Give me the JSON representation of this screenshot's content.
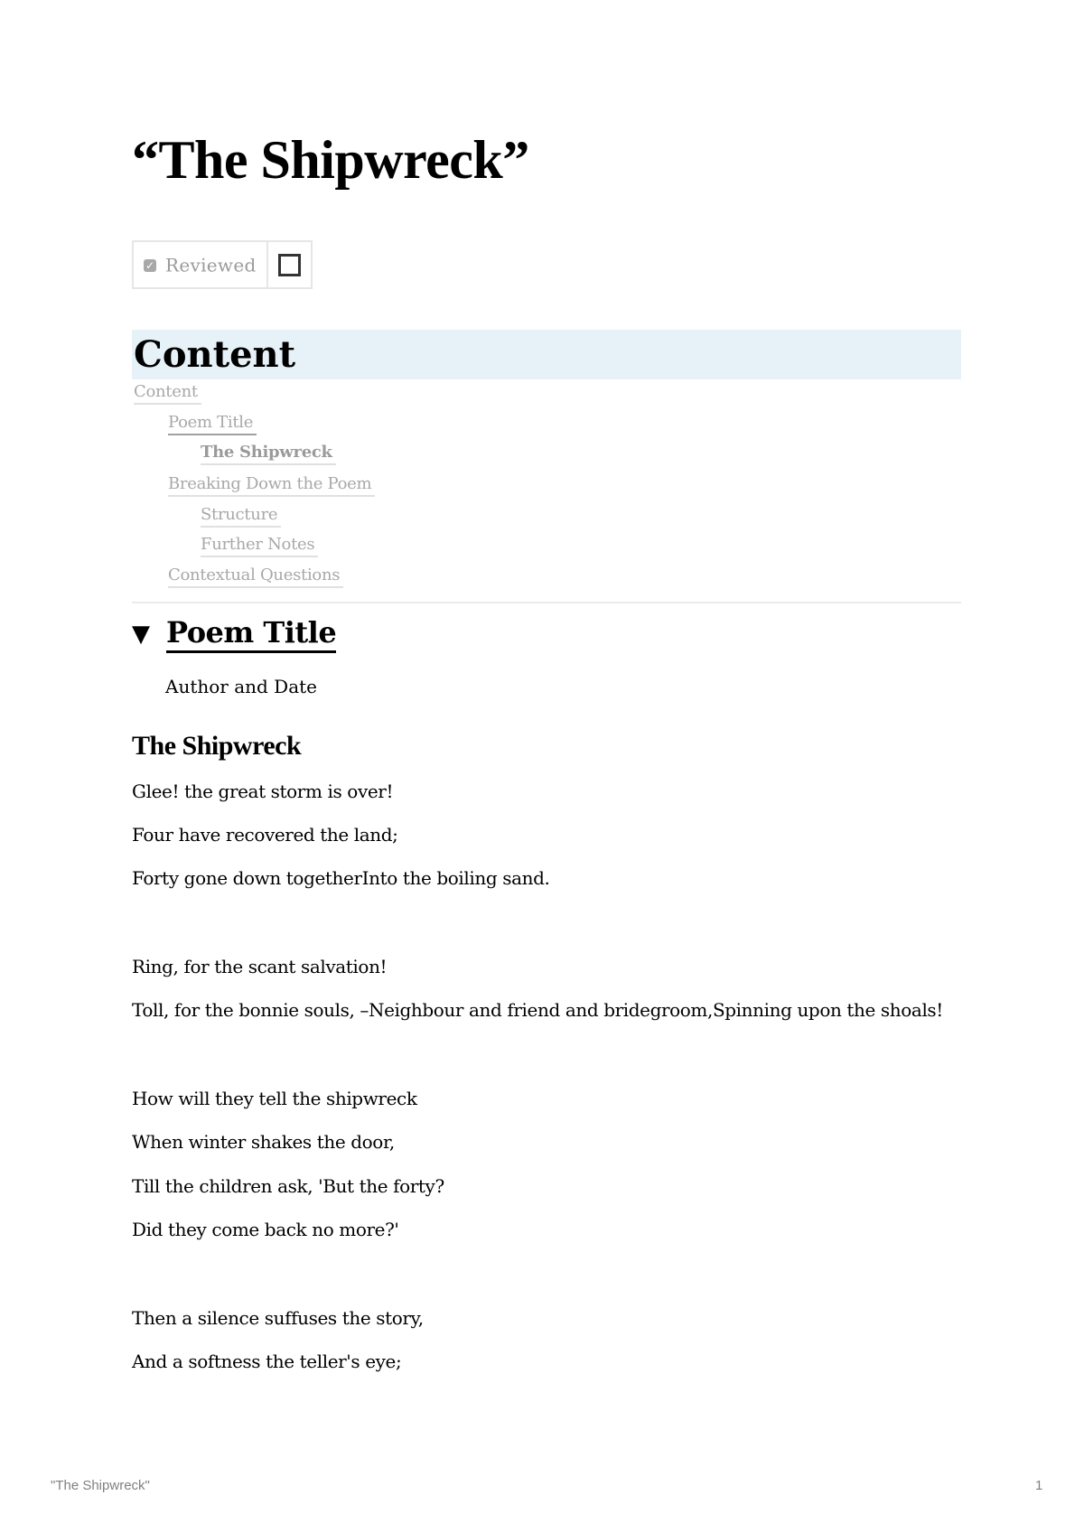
{
  "document": {
    "title": "“The Shipwreck”"
  },
  "properties": {
    "reviewed_icon": "checkbox-icon",
    "reviewed_label": "Reviewed",
    "reviewed_checked": false
  },
  "content_section": {
    "heading": "Content",
    "toc": [
      {
        "label": "Content",
        "level": 0
      },
      {
        "label": "Poem Title",
        "level": 1
      },
      {
        "label": "The Shipwreck",
        "level": 2
      },
      {
        "label": "Breaking Down the Poem",
        "level": 1
      },
      {
        "label": "Structure",
        "level": 2
      },
      {
        "label": "Further Notes",
        "level": 2
      },
      {
        "label": "Contextual Questions",
        "level": 1
      }
    ]
  },
  "poem_section": {
    "toggle_icon": "▼",
    "heading": "Poem Title",
    "author_line": "Author and Date",
    "poem_title": "The Shipwreck",
    "lines": [
      "Glee! the great storm is over!",
      "Four have recovered the land;",
      "Forty gone down togetherInto the boiling sand.",
      "Ring, for the scant salvation!",
      "Toll, for the bonnie souls, –Neighbour and friend and bridegroom,Spinning upon the shoals!",
      "How will they tell the shipwreck",
      "When winter shakes the door,",
      "Till the children ask, 'But the forty?",
      "Did they come back no more?'",
      "Then a silence suffuses the story,",
      "And a softness the teller's eye;"
    ]
  },
  "footer": {
    "left": "\"The Shipwreck\"",
    "page_number": "1"
  }
}
